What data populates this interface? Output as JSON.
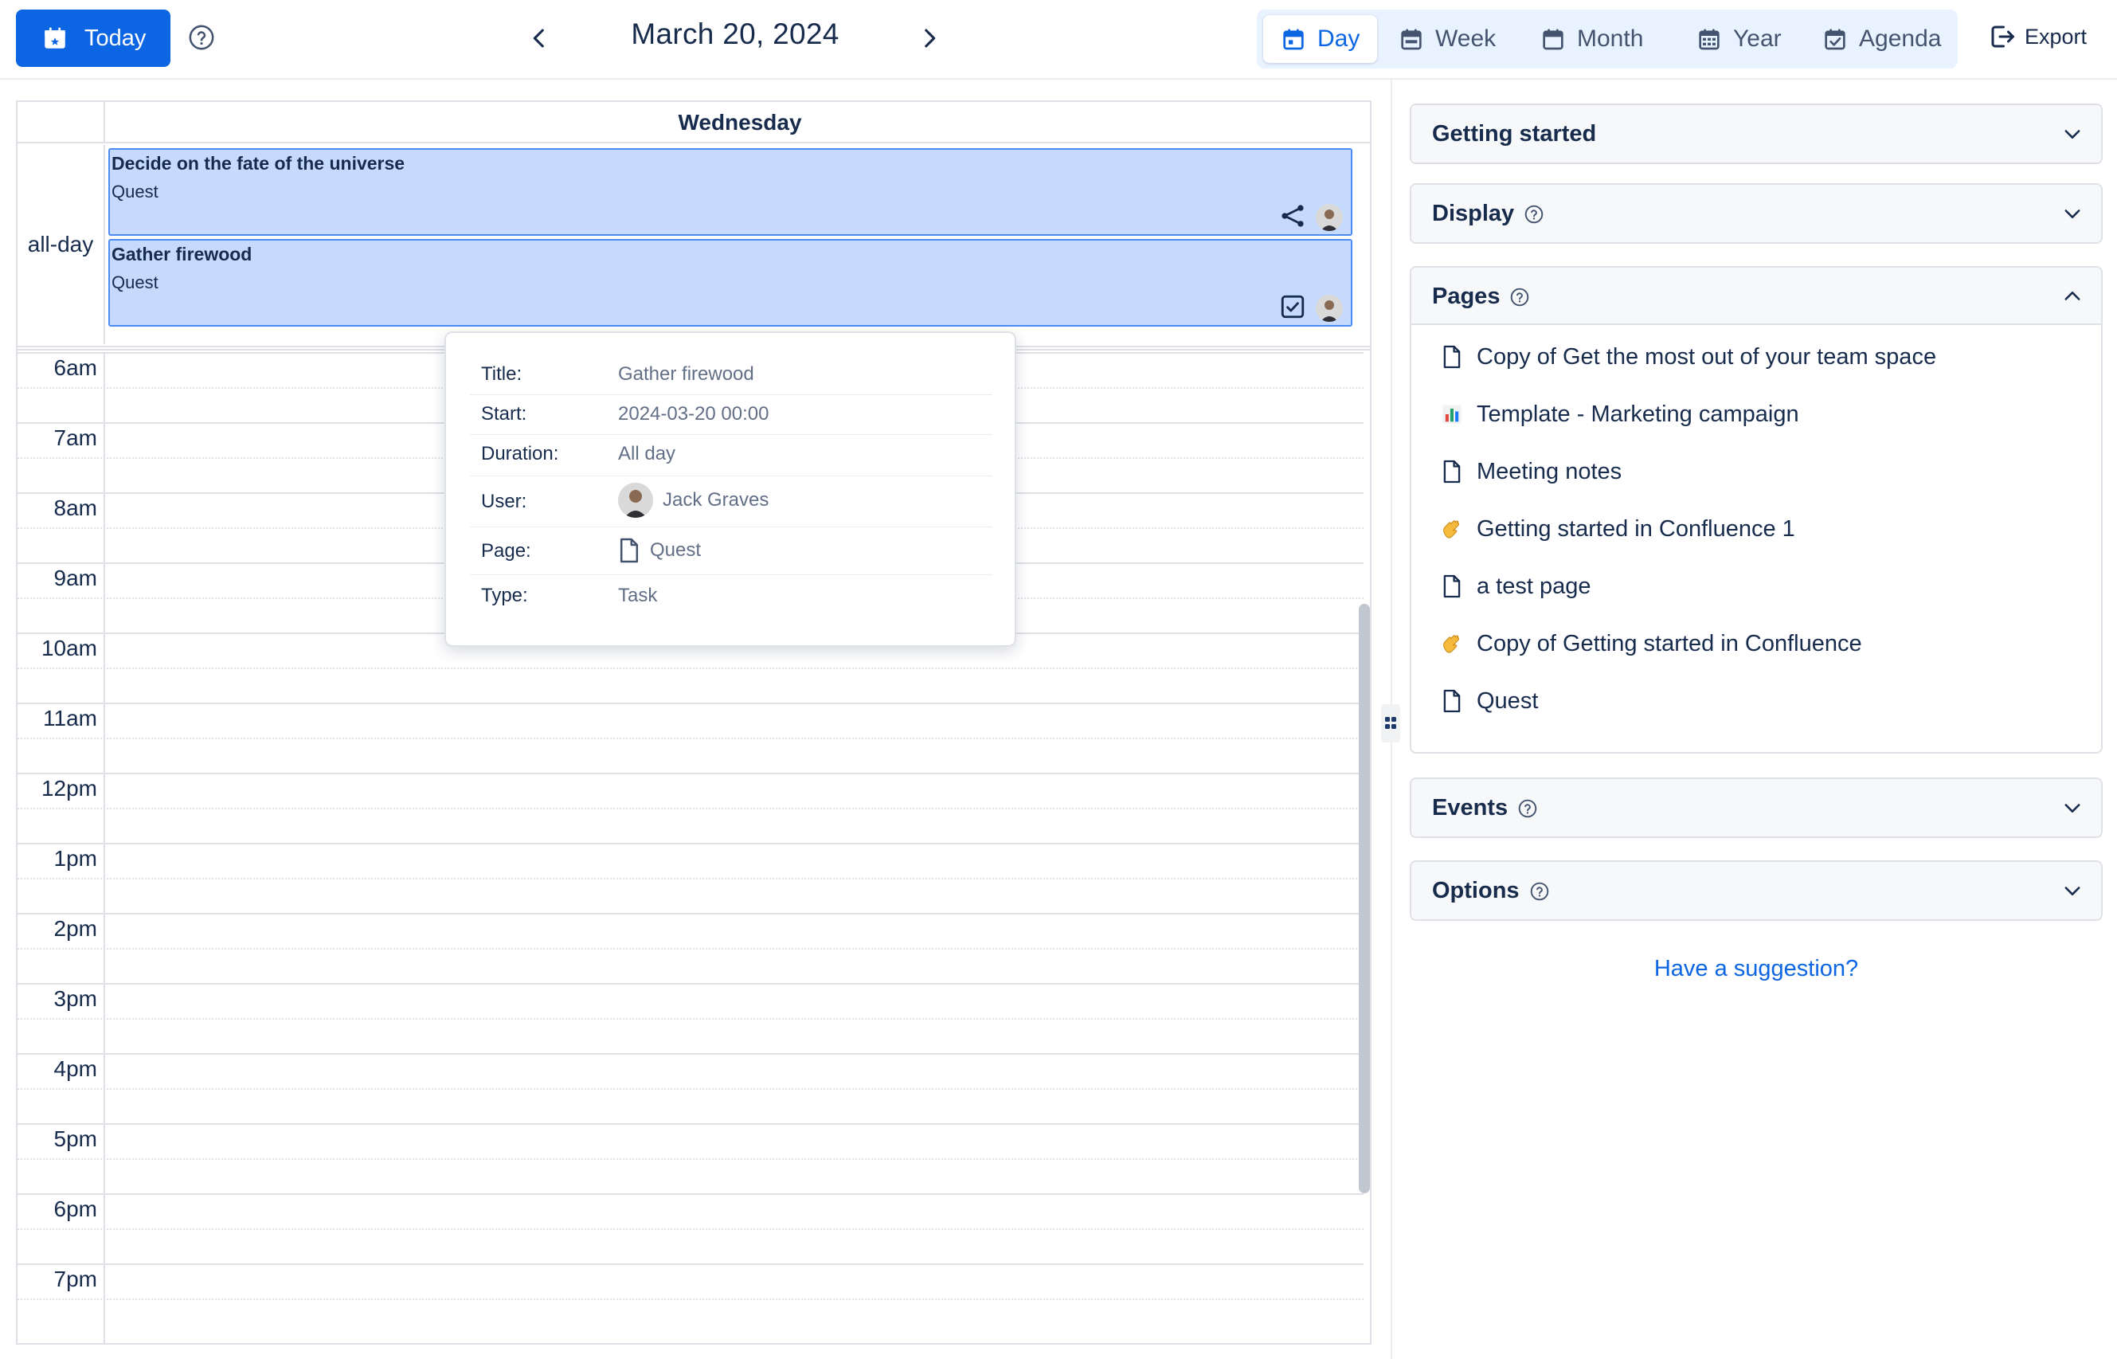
{
  "toolbar": {
    "today_label": "Today",
    "date_title": "March 20, 2024",
    "views": [
      {
        "label": "Day",
        "icon": "calendar-day-icon",
        "active": true
      },
      {
        "label": "Week",
        "icon": "calendar-week-icon",
        "active": false
      },
      {
        "label": "Month",
        "icon": "calendar-month-icon",
        "active": false
      },
      {
        "label": "Year",
        "icon": "calendar-year-icon",
        "active": false
      },
      {
        "label": "Agenda",
        "icon": "calendar-agenda-icon",
        "active": false
      }
    ],
    "export_label": "Export"
  },
  "calendar": {
    "day_name": "Wednesday",
    "allday_label": "all-day",
    "events": [
      {
        "title": "Decide on the fate of the universe",
        "page": "Quest",
        "icon": "share-icon"
      },
      {
        "title": "Gather firewood",
        "page": "Quest",
        "icon": "checkbox-icon"
      }
    ],
    "hours": [
      "6am",
      "7am",
      "8am",
      "9am",
      "10am",
      "11am",
      "12pm",
      "1pm",
      "2pm",
      "3pm",
      "4pm",
      "5pm",
      "6pm",
      "7pm"
    ]
  },
  "popover": {
    "title_label": "Title:",
    "title_value": "Gather firewood",
    "start_label": "Start:",
    "start_value": "2024-03-20 00:00",
    "duration_label": "Duration:",
    "duration_value": "All day",
    "user_label": "User:",
    "user_value": "Jack Graves",
    "page_label": "Page:",
    "page_value": "Quest",
    "type_label": "Type:",
    "type_value": "Task"
  },
  "sidebar": {
    "getting_started": "Getting started",
    "display": "Display",
    "pages": "Pages",
    "page_items": [
      {
        "label": "Copy of Get the most out of your team space",
        "icon": "document-icon"
      },
      {
        "label": "Template - Marketing campaign",
        "icon": "bar-chart-emoji"
      },
      {
        "label": "Meeting notes",
        "icon": "document-icon"
      },
      {
        "label": "Getting started in Confluence 1",
        "icon": "wave-emoji"
      },
      {
        "label": "a test page",
        "icon": "document-icon"
      },
      {
        "label": "Copy of Getting started in Confluence",
        "icon": "wave-emoji"
      },
      {
        "label": "Quest",
        "icon": "document-icon"
      }
    ],
    "events": "Events",
    "options": "Options",
    "suggestion": "Have a suggestion?"
  },
  "colors": {
    "accent": "#0c66e4",
    "event_fill": "#c5dafc",
    "event_border": "#4c8bf5",
    "view_switch_bg": "#e9f2ff"
  }
}
